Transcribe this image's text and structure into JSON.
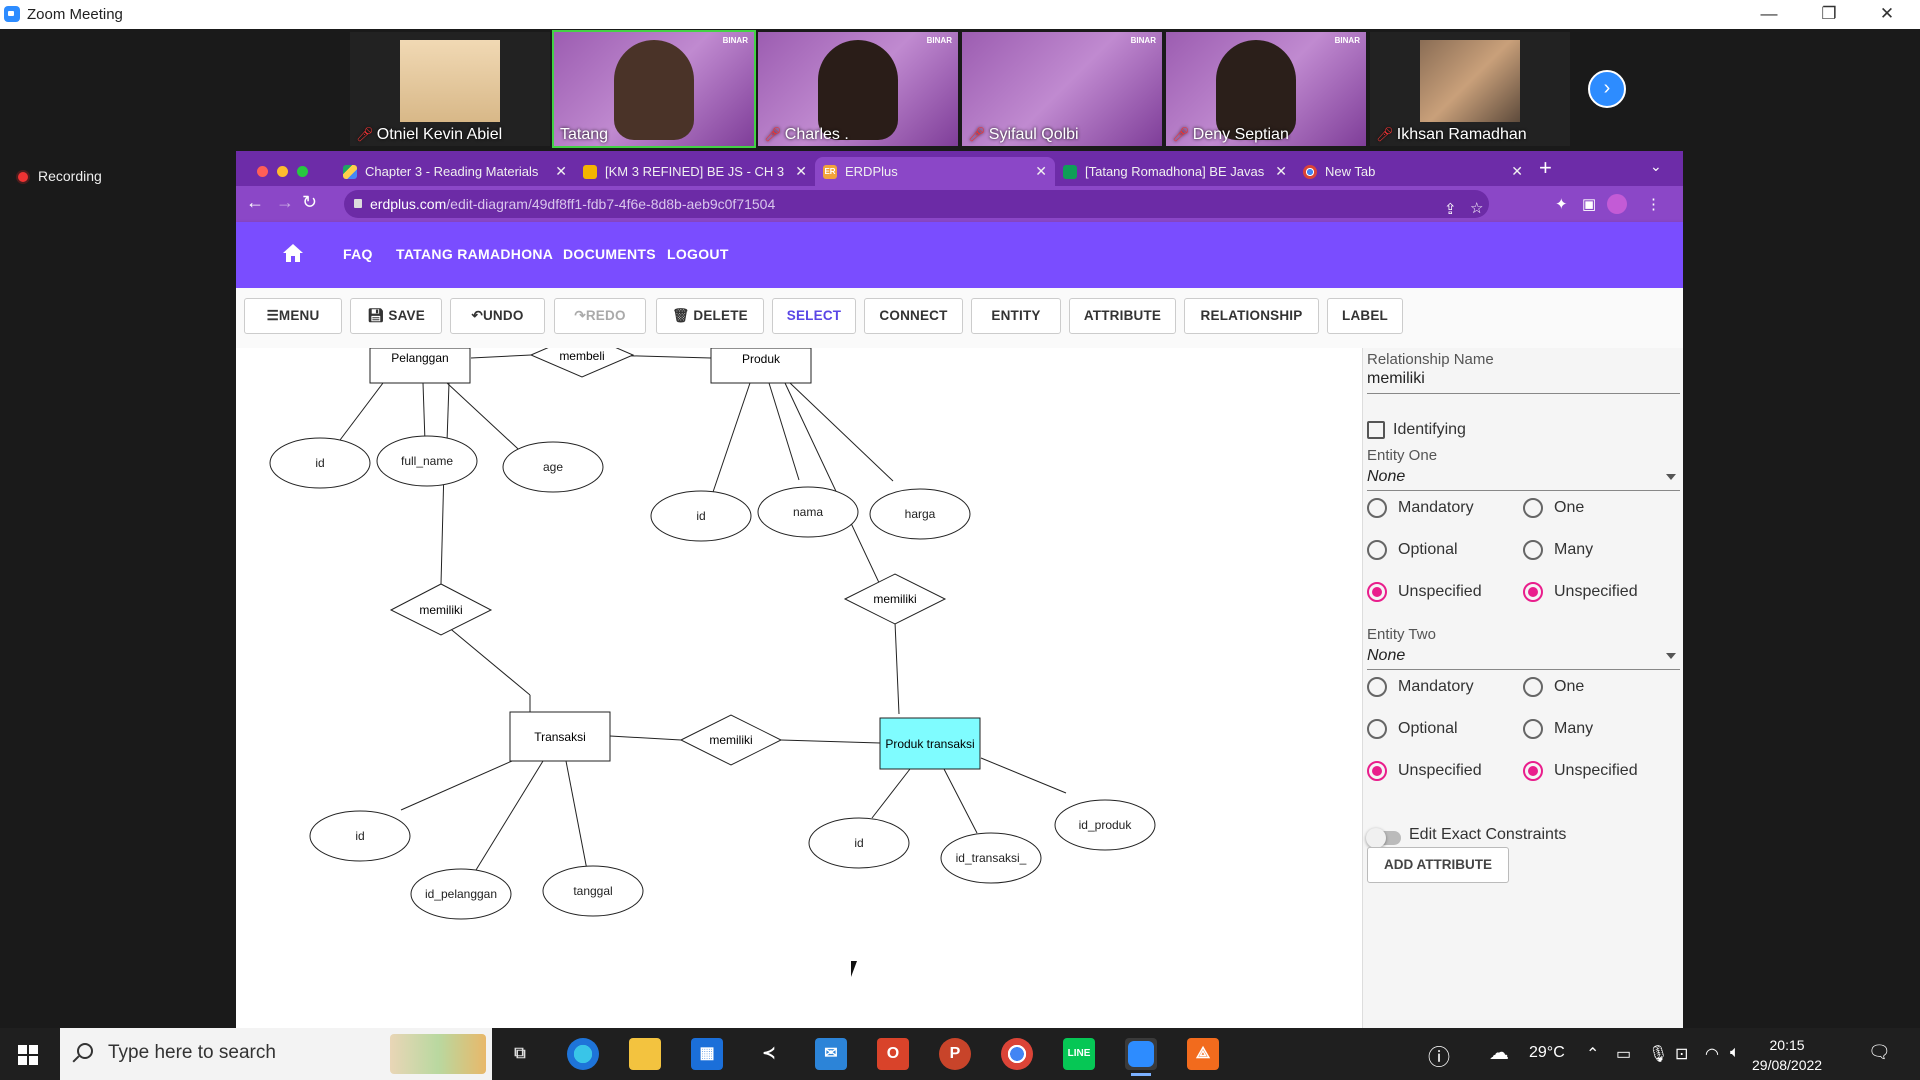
{
  "zoom": {
    "title": "Zoom Meeting",
    "recording_label": "Recording",
    "participants": [
      {
        "name": "Otniel Kevin Abiel",
        "muted": true
      },
      {
        "name": "Tatang",
        "muted": false
      },
      {
        "name": "Charles .",
        "muted": true
      },
      {
        "name": "Syifaul Qolbi",
        "muted": true
      },
      {
        "name": "Deny Septian",
        "muted": true
      },
      {
        "name": "Ikhsan Ramadhan",
        "muted": true
      }
    ],
    "binar_badge": "BINAR"
  },
  "browser": {
    "tabs": [
      {
        "title": "Chapter 3 - Reading Materials",
        "icon": "drive-icon",
        "color": "#1fa463"
      },
      {
        "title": "[KM 3 REFINED] BE JS - CH 3",
        "icon": "slides-icon",
        "color": "#f4b400"
      },
      {
        "title": "ERDPlus",
        "icon": "erdplus-icon",
        "color": "#f2a33a",
        "active": true
      },
      {
        "title": "[Tatang Romadhona] BE Javas",
        "icon": "sheets-icon",
        "color": "#0f9d58"
      },
      {
        "title": "New Tab",
        "icon": "chrome-icon",
        "color": "#cccccc"
      }
    ],
    "url_host": "erdplus.com",
    "url_path": "/edit-diagram/49df8ff1-fdb7-4f6e-8d8b-aeb9c0f71504"
  },
  "erdplus": {
    "nav": {
      "faq": "FAQ",
      "user": "TATANG RAMADHONA",
      "documents": "DOCUMENTS",
      "logout": "LOGOUT"
    },
    "toolbar": {
      "menu": "MENU",
      "save": "SAVE",
      "undo": "UNDO",
      "redo": "REDO",
      "delete": "DELETE",
      "select": "SELECT",
      "connect": "CONNECT",
      "entity": "ENTITY",
      "attribute": "ATTRIBUTE",
      "relationship": "RELATIONSHIP",
      "label": "LABEL"
    },
    "diagram": {
      "entities": [
        "Pelanggan",
        "Produk",
        "Transaksi",
        "Produk transaksi"
      ],
      "relationships": [
        "membeli",
        "memiliki",
        "memiliki",
        "memiliki"
      ],
      "pelanggan_attrs": [
        "id",
        "full_name",
        "age"
      ],
      "produk_attrs": [
        "id",
        "nama",
        "harga"
      ],
      "transaksi_attrs": [
        "id",
        "id_pelanggan",
        "tanggal"
      ],
      "produk_transaksi_attrs": [
        "id",
        "id_transaksi_",
        "id_produk"
      ],
      "selected_color": "#7ffcff"
    },
    "panel": {
      "rel_name_label": "Relationship Name",
      "rel_name_value": "memiliki",
      "identifying_label": "Identifying",
      "entity_one_label": "Entity One",
      "entity_one_value": "None",
      "entity_two_label": "Entity Two",
      "entity_two_value": "None",
      "mandatory": "Mandatory",
      "optional": "Optional",
      "unspecified": "Unspecified",
      "one": "One",
      "many": "Many",
      "edit_exact": "Edit Exact Constraints",
      "add_attribute": "ADD ATTRIBUTE"
    }
  },
  "taskbar": {
    "search_placeholder": "Type here to search",
    "weather": "29°C",
    "time": "20:15",
    "date": "29/08/2022"
  }
}
